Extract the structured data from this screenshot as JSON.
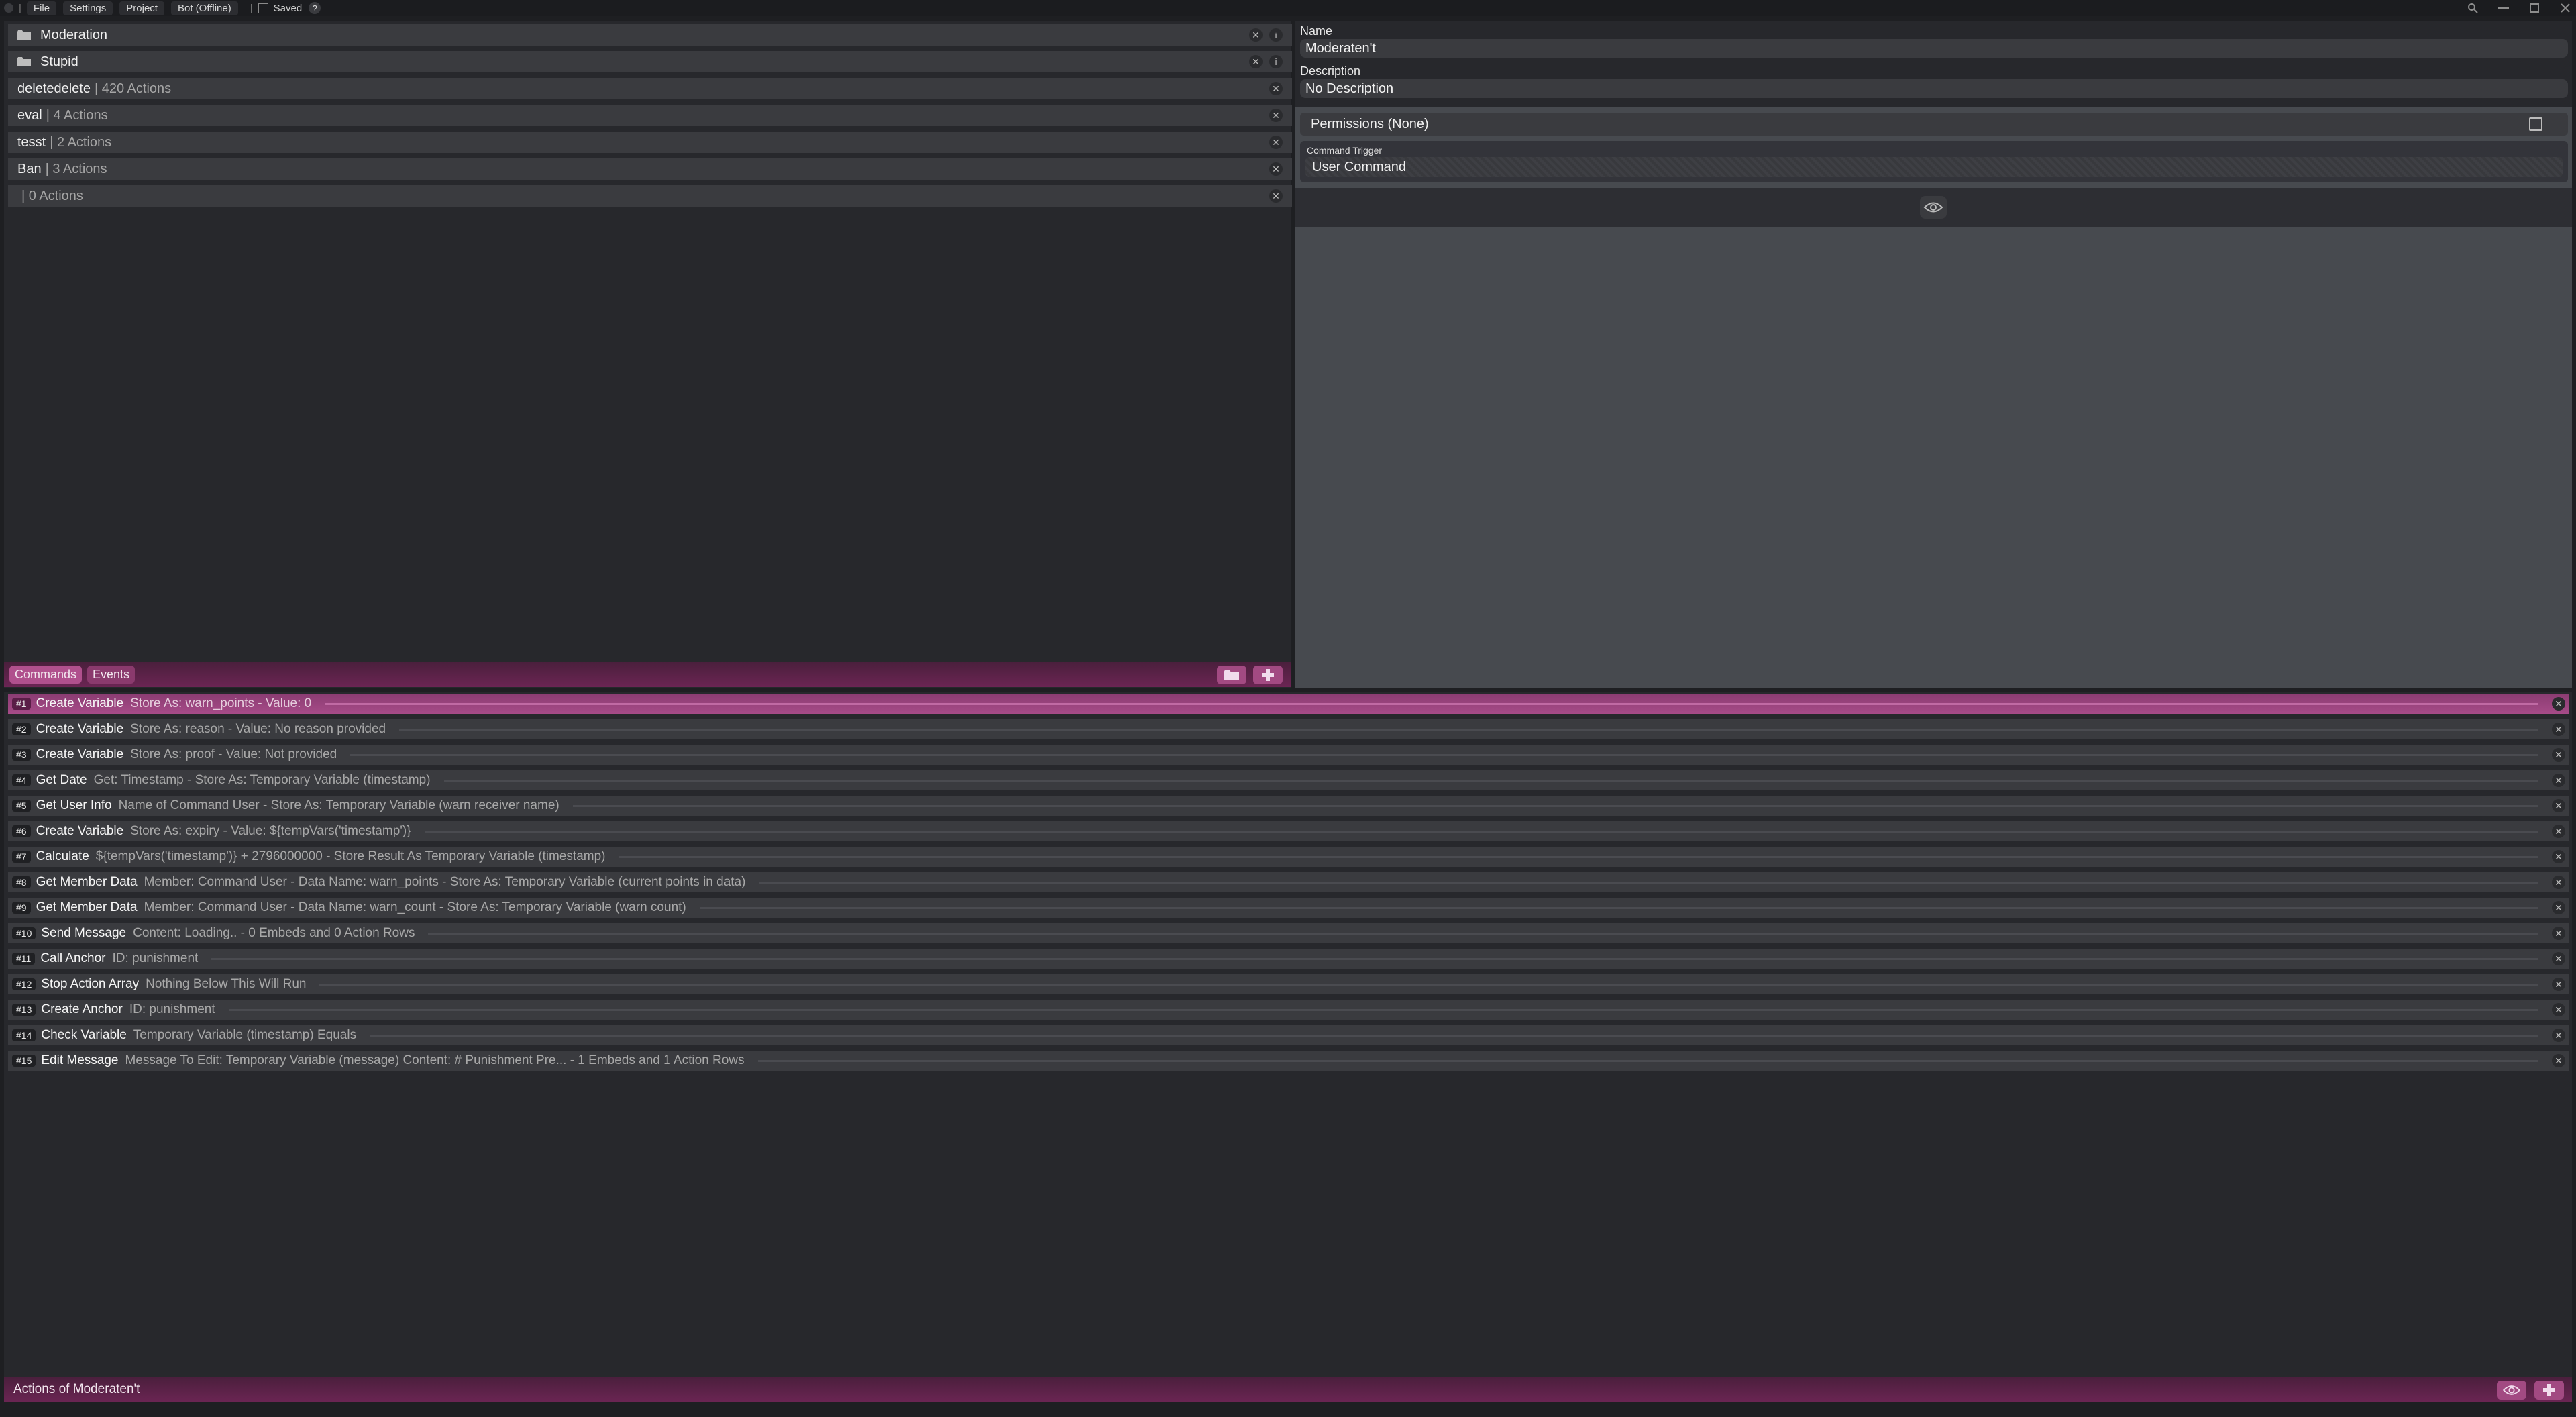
{
  "menubar": {
    "items": [
      "File",
      "Settings",
      "Project",
      "Bot (Offline)"
    ],
    "saved_label": "Saved",
    "help_label": "?"
  },
  "commands": {
    "folders": [
      {
        "name": "Moderation"
      },
      {
        "name": "Stupid"
      }
    ],
    "items": [
      {
        "name": "deletedelete",
        "sub": "| 420 Actions"
      },
      {
        "name": "eval",
        "sub": "| 4 Actions"
      },
      {
        "name": "tesst",
        "sub": "| 2 Actions"
      },
      {
        "name": "Ban",
        "sub": "| 3 Actions"
      },
      {
        "name": "",
        "sub": "| 0 Actions"
      }
    ]
  },
  "tabs": {
    "commands": "Commands",
    "events": "Events"
  },
  "properties": {
    "name_label": "Name",
    "name_value": "Moderaten't",
    "description_label": "Description",
    "description_value": "No Description",
    "permissions_label": "Permissions (None)",
    "trigger_label": "Command Trigger",
    "trigger_value": "User Command"
  },
  "actions": [
    {
      "num": "#1",
      "name": "Create Variable",
      "desc": "Store As: warn_points - Value: 0"
    },
    {
      "num": "#2",
      "name": "Create Variable",
      "desc": "Store As: reason - Value: No reason provided"
    },
    {
      "num": "#3",
      "name": "Create Variable",
      "desc": "Store As: proof - Value: Not provided"
    },
    {
      "num": "#4",
      "name": "Get Date",
      "desc": "Get: Timestamp - Store As: Temporary Variable (timestamp)"
    },
    {
      "num": "#5",
      "name": "Get User Info",
      "desc": "Name of Command User - Store As: Temporary Variable (warn receiver name)"
    },
    {
      "num": "#6",
      "name": "Create Variable",
      "desc": "Store As: expiry - Value: ${tempVars('timestamp')}"
    },
    {
      "num": "#7",
      "name": "Calculate",
      "desc": "${tempVars('timestamp')} + 2796000000 - Store Result As Temporary Variable (timestamp)"
    },
    {
      "num": "#8",
      "name": "Get Member Data",
      "desc": "Member: Command User - Data Name: warn_points - Store As: Temporary Variable (current points in data)"
    },
    {
      "num": "#9",
      "name": "Get Member Data",
      "desc": "Member: Command User - Data Name: warn_count - Store As: Temporary Variable (warn count)"
    },
    {
      "num": "#10",
      "name": "Send Message",
      "desc": "Content: Loading.. - 0 Embeds and 0 Action Rows"
    },
    {
      "num": "#11",
      "name": "Call Anchor",
      "desc": "ID: punishment"
    },
    {
      "num": "#12",
      "name": "Stop Action Array",
      "desc": "Nothing Below This Will Run"
    },
    {
      "num": "#13",
      "name": "Create Anchor",
      "desc": "ID: punishment"
    },
    {
      "num": "#14",
      "name": "Check Variable",
      "desc": "Temporary Variable (timestamp) Equals"
    },
    {
      "num": "#15",
      "name": "Edit Message",
      "desc": "Message To Edit: Temporary Variable (message) Content: # Punishment Pre... - 1 Embeds and 1 Action Rows"
    }
  ],
  "actions_footer_title": "Actions of Moderaten't",
  "colors": {
    "accent": "#a24a82",
    "footer": "#6b2553",
    "background": "#27282c"
  }
}
